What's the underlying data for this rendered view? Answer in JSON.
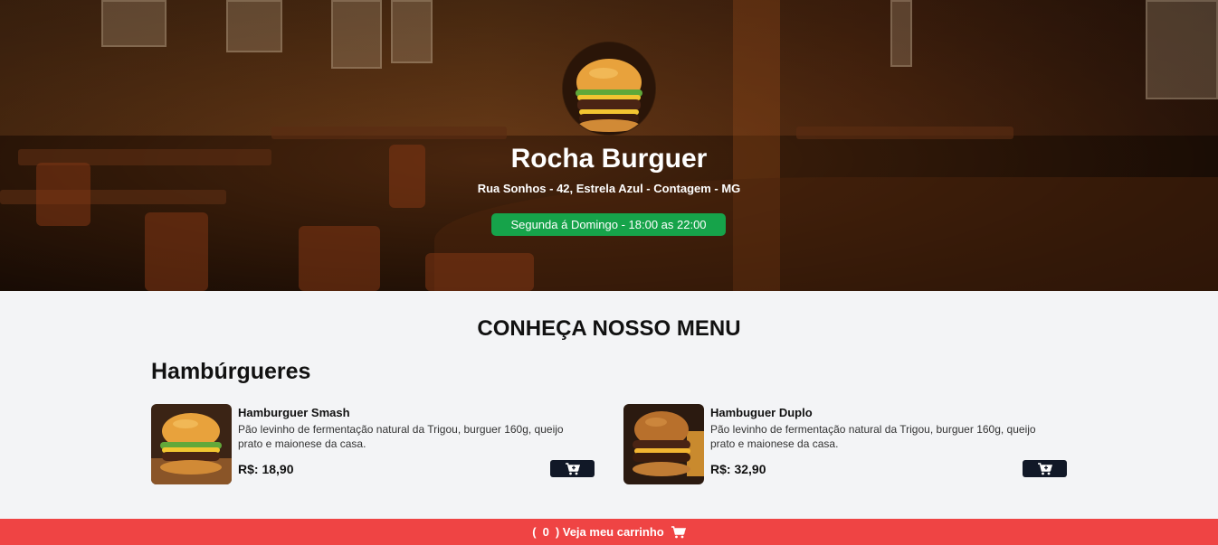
{
  "header": {
    "name": "Rocha Burguer",
    "address": "Rua Sonhos - 42, Estrela Azul - Contagem - MG",
    "hours": "Segunda á Domingo - 18:00 as 22:00",
    "hours_color": "#16a34a"
  },
  "menu": {
    "title": "CONHEÇA NOSSO MENU",
    "categories": [
      {
        "title": "Hambúrgueres",
        "products": [
          {
            "name": "Hamburguer Smash",
            "description": "Pão levinho de fermentação natural da Trigou, burguer 160g, queijo prato e maionese da casa.",
            "price": "R$: 18,90",
            "icon": "cart-plus-icon"
          },
          {
            "name": "Hambuguer Duplo",
            "description": "Pão levinho de fermentação natural da Trigou, burguer 160g, queijo prato e maionese da casa.",
            "price": "R$: 32,90",
            "icon": "cart-plus-icon"
          }
        ]
      }
    ]
  },
  "cart": {
    "open_paren": "(",
    "count": "0",
    "label": ") Veja meu carrinho",
    "icon": "cart-icon",
    "color": "#ef4444"
  },
  "colors": {
    "button_dark": "#111827",
    "background": "#f3f4f6"
  }
}
